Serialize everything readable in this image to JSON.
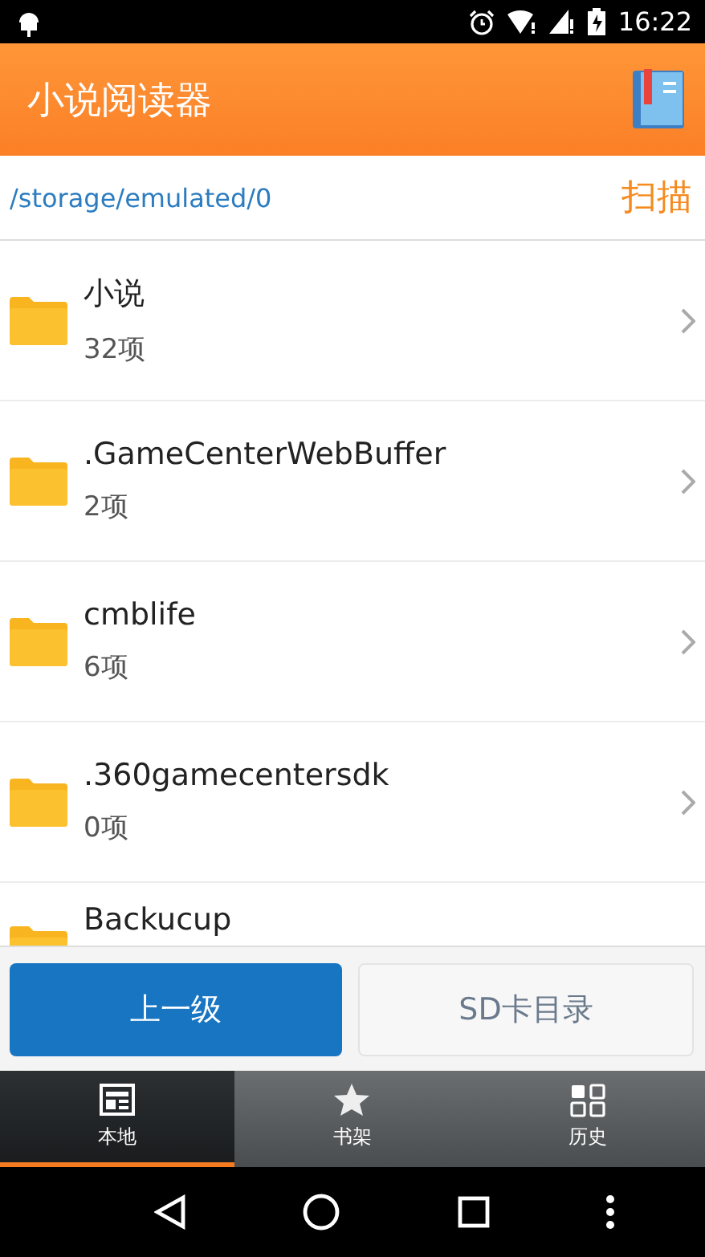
{
  "status_bar": {
    "time": "16:22"
  },
  "toolbar": {
    "title": "小说阅读器"
  },
  "path_bar": {
    "path": "/storage/emulated/0",
    "scan": "扫描"
  },
  "folders": [
    {
      "name": "小说",
      "count": "32项"
    },
    {
      "name": ".GameCenterWebBuffer",
      "count": "2项"
    },
    {
      "name": "cmblife",
      "count": "6项"
    },
    {
      "name": ".360gamecentersdk",
      "count": "0项"
    },
    {
      "name": "Backucup"
    }
  ],
  "buttons": [
    {
      "label": "上一级",
      "kind": "primary"
    },
    {
      "label": "SD卡目录",
      "kind": "secondary"
    }
  ],
  "tabs": [
    {
      "label": "本地",
      "selected": true
    },
    {
      "label": "书架",
      "selected": false
    },
    {
      "label": "历史",
      "selected": false
    }
  ]
}
